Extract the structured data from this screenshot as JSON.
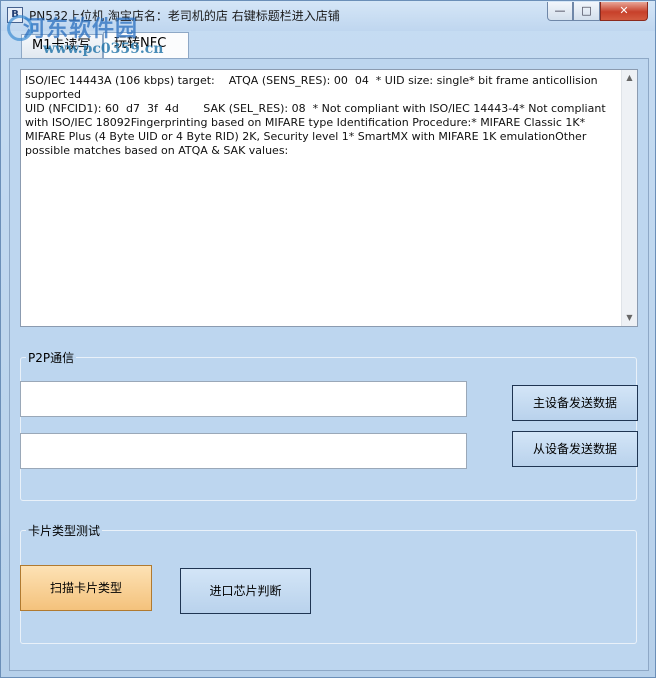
{
  "window": {
    "title": "PN532上位机 淘宝店名：老司机的店 右键标题栏进入店铺",
    "icon_label": "B",
    "controls": {
      "minimize": "—",
      "maximize": "□",
      "close": "✕"
    }
  },
  "watermark": {
    "text": "河东软件园",
    "url": "www.pc0359.cn"
  },
  "tabs": [
    {
      "label": "M1卡读写"
    },
    {
      "label": "玩转NFC"
    }
  ],
  "log": {
    "text": "ISO/IEC 14443A (106 kbps) target:    ATQA (SENS_RES): 00  04  * UID size: single* bit frame anticollision supported\nUID (NFCID1): 60  d7  3f  4d       SAK (SEL_RES): 08  * Not compliant with ISO/IEC 14443-4* Not compliant with ISO/IEC 18092Fingerprinting based on MIFARE type Identification Procedure:* MIFARE Classic 1K* MIFARE Plus (4 Byte UID or 4 Byte RID) 2K, Security level 1* SmartMX with MIFARE 1K emulationOther possible matches based on ATQA & SAK values:"
  },
  "p2p": {
    "title": "P2P通信",
    "input1_value": "",
    "input2_value": "",
    "master_send_label": "主设备发送数据",
    "slave_send_label": "从设备发送数据"
  },
  "card_test": {
    "title": "卡片类型测试",
    "scan_label": "扫描卡片类型",
    "chip_label": "进口芯片判断"
  },
  "colors": {
    "window_bg": "#bdd6ef",
    "scan_button": "#f4c27c",
    "close_button": "#c7402a"
  }
}
